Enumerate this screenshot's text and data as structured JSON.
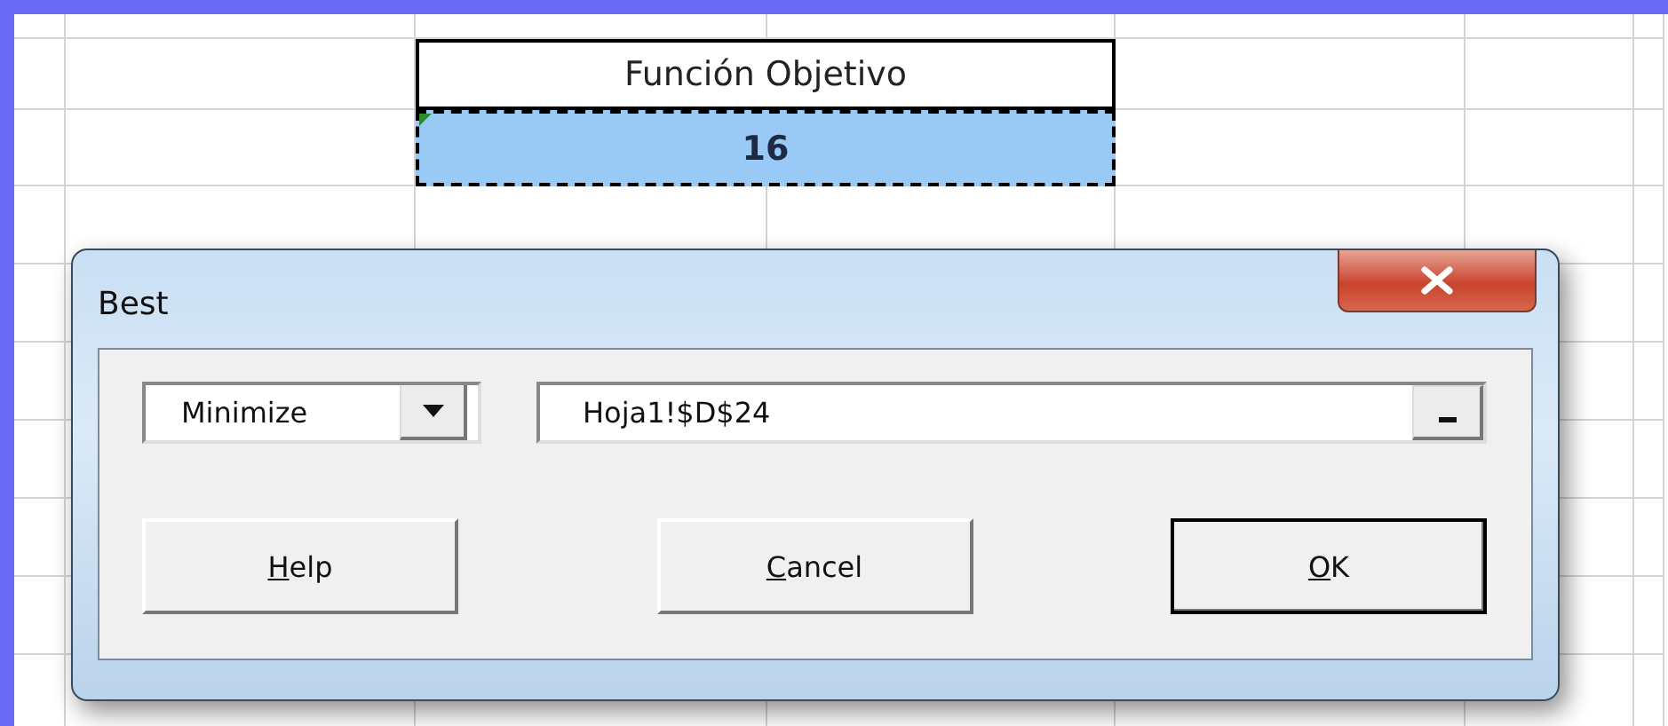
{
  "sheet": {
    "header_cell": "Función Objetivo",
    "value_cell": {
      "text": "16",
      "selected": true
    }
  },
  "dialog": {
    "title": "Best",
    "goal_dropdown": {
      "value": "Minimize"
    },
    "cell_field": {
      "value": "Hoja1!$D$24"
    },
    "buttons": [
      {
        "label": "Help",
        "mnemonic": true,
        "default": false
      },
      {
        "label": "Cancel",
        "mnemonic": true,
        "default": false
      },
      {
        "label": "OK",
        "mnemonic": true,
        "default": true
      }
    ]
  }
}
